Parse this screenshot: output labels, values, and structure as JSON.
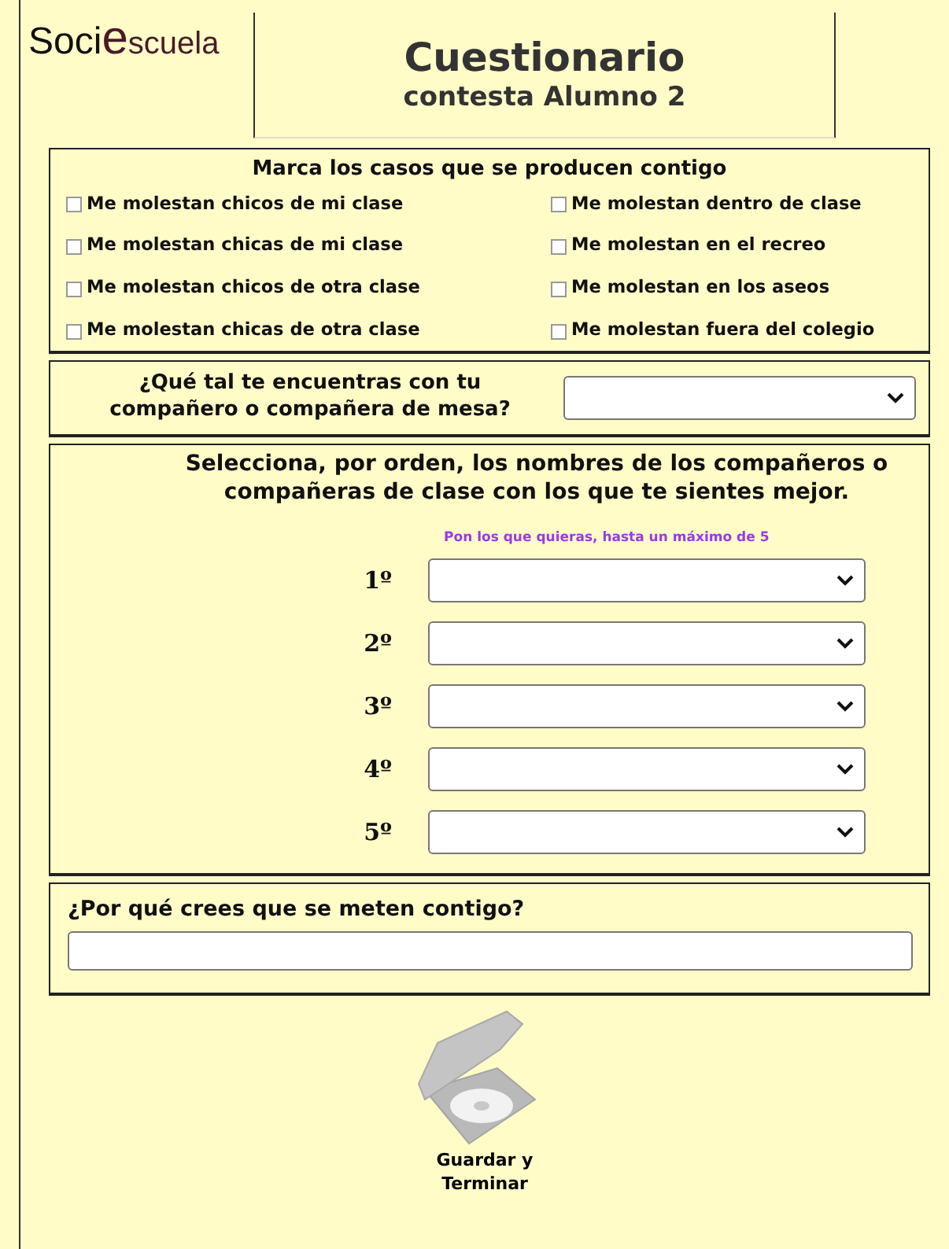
{
  "logo": {
    "parts": [
      "Soci",
      "e",
      "scuela"
    ]
  },
  "header": {
    "title": "Cuestionario",
    "subtitle": "contesta Alumno 2"
  },
  "cases": {
    "title": "Marca los casos que se producen contigo",
    "items": [
      {
        "label": "Me molestan chicos de mi clase",
        "checked": false
      },
      {
        "label": "Me molestan dentro de clase",
        "checked": false
      },
      {
        "label": "Me molestan chicas de mi clase",
        "checked": false
      },
      {
        "label": "Me molestan en el recreo",
        "checked": false
      },
      {
        "label": "Me molestan chicos de otra clase",
        "checked": false
      },
      {
        "label": "Me molestan en los aseos",
        "checked": false
      },
      {
        "label": "Me molestan chicas de otra clase",
        "checked": false
      },
      {
        "label": "Me molestan fuera del colegio",
        "checked": false
      }
    ]
  },
  "desk": {
    "question": "¿Qué tal te encuentras con tu compañero o compañera de mesa?"
  },
  "ranking": {
    "title": "Selecciona, por orden, los nombres de los compañeros o compañeras de clase con los que te sientes mejor.",
    "hint": "Pon los que quieras, hasta un máximo de 5",
    "slots": [
      {
        "label": "1º"
      },
      {
        "label": "2º"
      },
      {
        "label": "3º"
      },
      {
        "label": "4º"
      },
      {
        "label": "5º"
      }
    ]
  },
  "why": {
    "question": "¿Por qué crees que se meten contigo?"
  },
  "save": {
    "label": "Guardar y Terminar"
  }
}
